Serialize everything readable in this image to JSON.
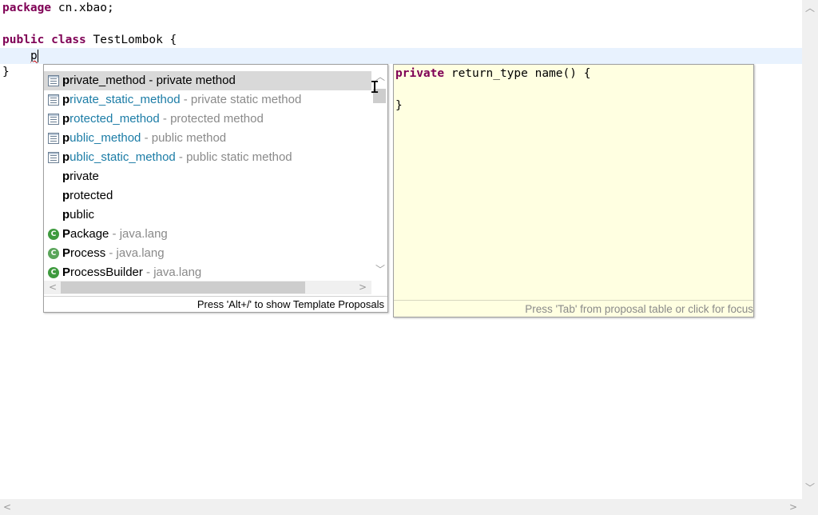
{
  "editor": {
    "lines": {
      "l1_kw": "package",
      "l1_rest": " cn.xbao;",
      "l3_kw1": "public",
      "l3_kw2": "class",
      "l3_rest": " TestLombok {",
      "l4_typed": "p",
      "l5": "}"
    }
  },
  "completion": {
    "proposals": [
      {
        "prefix": "p",
        "rest": "rivate_method",
        "desc": " - private method",
        "icon": "template-icon",
        "selected": true
      },
      {
        "prefix": "p",
        "rest": "rivate_static_method",
        "desc": " - private static method",
        "icon": "template-icon"
      },
      {
        "prefix": "p",
        "rest": "rotected_method",
        "desc": " - protected method",
        "icon": "template-icon"
      },
      {
        "prefix": "p",
        "rest": "ublic_method",
        "desc": " - public method",
        "icon": "template-icon"
      },
      {
        "prefix": "p",
        "rest": "ublic_static_method",
        "desc": " - public static method",
        "icon": "template-icon"
      },
      {
        "prefix": "p",
        "rest": "rivate",
        "desc": "",
        "icon": "none"
      },
      {
        "prefix": "p",
        "rest": "rotected",
        "desc": "",
        "icon": "none"
      },
      {
        "prefix": "p",
        "rest": "ublic",
        "desc": "",
        "icon": "none"
      },
      {
        "prefix": "P",
        "rest": "ackage",
        "desc": " - java.lang",
        "icon": "class-icon"
      },
      {
        "prefix": "P",
        "rest": "rocess",
        "desc": " - java.lang",
        "icon": "abstract-class-icon"
      },
      {
        "prefix": "P",
        "rest": "rocessBuilder",
        "desc": " - java.lang",
        "icon": "class-icon"
      }
    ],
    "footer": "Press 'Alt+/' to show Template Proposals"
  },
  "info": {
    "line1_kw": "private",
    "line1_rest": " return_type name() {",
    "line3": "}",
    "footer": "Press 'Tab' from proposal table or click for focus"
  },
  "icons": {
    "scroll_up": "▲",
    "scroll_down": "▼",
    "scroll_left": "◀",
    "scroll_right": "▶"
  },
  "colors": {
    "keyword": "#7f0055",
    "template_name": "#1b7ca6",
    "current_line": "#e8f2fe",
    "info_bg": "#ffffe1",
    "selection": "#d9d9d9"
  }
}
